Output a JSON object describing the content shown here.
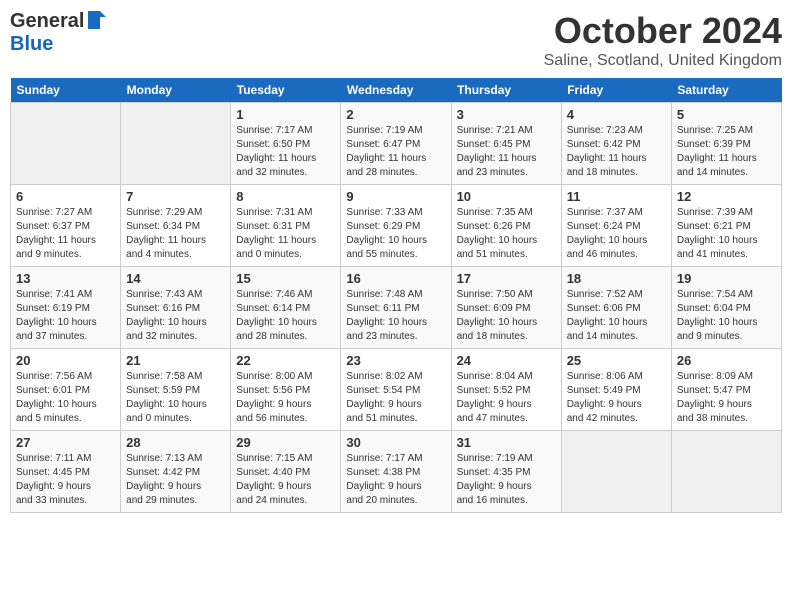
{
  "header": {
    "logo_general": "General",
    "logo_blue": "Blue",
    "month": "October 2024",
    "location": "Saline, Scotland, United Kingdom"
  },
  "days_of_week": [
    "Sunday",
    "Monday",
    "Tuesday",
    "Wednesday",
    "Thursday",
    "Friday",
    "Saturday"
  ],
  "weeks": [
    [
      {
        "date": "",
        "lines": []
      },
      {
        "date": "",
        "lines": []
      },
      {
        "date": "1",
        "lines": [
          "Sunrise: 7:17 AM",
          "Sunset: 6:50 PM",
          "Daylight: 11 hours",
          "and 32 minutes."
        ]
      },
      {
        "date": "2",
        "lines": [
          "Sunrise: 7:19 AM",
          "Sunset: 6:47 PM",
          "Daylight: 11 hours",
          "and 28 minutes."
        ]
      },
      {
        "date": "3",
        "lines": [
          "Sunrise: 7:21 AM",
          "Sunset: 6:45 PM",
          "Daylight: 11 hours",
          "and 23 minutes."
        ]
      },
      {
        "date": "4",
        "lines": [
          "Sunrise: 7:23 AM",
          "Sunset: 6:42 PM",
          "Daylight: 11 hours",
          "and 18 minutes."
        ]
      },
      {
        "date": "5",
        "lines": [
          "Sunrise: 7:25 AM",
          "Sunset: 6:39 PM",
          "Daylight: 11 hours",
          "and 14 minutes."
        ]
      }
    ],
    [
      {
        "date": "6",
        "lines": [
          "Sunrise: 7:27 AM",
          "Sunset: 6:37 PM",
          "Daylight: 11 hours",
          "and 9 minutes."
        ]
      },
      {
        "date": "7",
        "lines": [
          "Sunrise: 7:29 AM",
          "Sunset: 6:34 PM",
          "Daylight: 11 hours",
          "and 4 minutes."
        ]
      },
      {
        "date": "8",
        "lines": [
          "Sunrise: 7:31 AM",
          "Sunset: 6:31 PM",
          "Daylight: 11 hours",
          "and 0 minutes."
        ]
      },
      {
        "date": "9",
        "lines": [
          "Sunrise: 7:33 AM",
          "Sunset: 6:29 PM",
          "Daylight: 10 hours",
          "and 55 minutes."
        ]
      },
      {
        "date": "10",
        "lines": [
          "Sunrise: 7:35 AM",
          "Sunset: 6:26 PM",
          "Daylight: 10 hours",
          "and 51 minutes."
        ]
      },
      {
        "date": "11",
        "lines": [
          "Sunrise: 7:37 AM",
          "Sunset: 6:24 PM",
          "Daylight: 10 hours",
          "and 46 minutes."
        ]
      },
      {
        "date": "12",
        "lines": [
          "Sunrise: 7:39 AM",
          "Sunset: 6:21 PM",
          "Daylight: 10 hours",
          "and 41 minutes."
        ]
      }
    ],
    [
      {
        "date": "13",
        "lines": [
          "Sunrise: 7:41 AM",
          "Sunset: 6:19 PM",
          "Daylight: 10 hours",
          "and 37 minutes."
        ]
      },
      {
        "date": "14",
        "lines": [
          "Sunrise: 7:43 AM",
          "Sunset: 6:16 PM",
          "Daylight: 10 hours",
          "and 32 minutes."
        ]
      },
      {
        "date": "15",
        "lines": [
          "Sunrise: 7:46 AM",
          "Sunset: 6:14 PM",
          "Daylight: 10 hours",
          "and 28 minutes."
        ]
      },
      {
        "date": "16",
        "lines": [
          "Sunrise: 7:48 AM",
          "Sunset: 6:11 PM",
          "Daylight: 10 hours",
          "and 23 minutes."
        ]
      },
      {
        "date": "17",
        "lines": [
          "Sunrise: 7:50 AM",
          "Sunset: 6:09 PM",
          "Daylight: 10 hours",
          "and 18 minutes."
        ]
      },
      {
        "date": "18",
        "lines": [
          "Sunrise: 7:52 AM",
          "Sunset: 6:06 PM",
          "Daylight: 10 hours",
          "and 14 minutes."
        ]
      },
      {
        "date": "19",
        "lines": [
          "Sunrise: 7:54 AM",
          "Sunset: 6:04 PM",
          "Daylight: 10 hours",
          "and 9 minutes."
        ]
      }
    ],
    [
      {
        "date": "20",
        "lines": [
          "Sunrise: 7:56 AM",
          "Sunset: 6:01 PM",
          "Daylight: 10 hours",
          "and 5 minutes."
        ]
      },
      {
        "date": "21",
        "lines": [
          "Sunrise: 7:58 AM",
          "Sunset: 5:59 PM",
          "Daylight: 10 hours",
          "and 0 minutes."
        ]
      },
      {
        "date": "22",
        "lines": [
          "Sunrise: 8:00 AM",
          "Sunset: 5:56 PM",
          "Daylight: 9 hours",
          "and 56 minutes."
        ]
      },
      {
        "date": "23",
        "lines": [
          "Sunrise: 8:02 AM",
          "Sunset: 5:54 PM",
          "Daylight: 9 hours",
          "and 51 minutes."
        ]
      },
      {
        "date": "24",
        "lines": [
          "Sunrise: 8:04 AM",
          "Sunset: 5:52 PM",
          "Daylight: 9 hours",
          "and 47 minutes."
        ]
      },
      {
        "date": "25",
        "lines": [
          "Sunrise: 8:06 AM",
          "Sunset: 5:49 PM",
          "Daylight: 9 hours",
          "and 42 minutes."
        ]
      },
      {
        "date": "26",
        "lines": [
          "Sunrise: 8:09 AM",
          "Sunset: 5:47 PM",
          "Daylight: 9 hours",
          "and 38 minutes."
        ]
      }
    ],
    [
      {
        "date": "27",
        "lines": [
          "Sunrise: 7:11 AM",
          "Sunset: 4:45 PM",
          "Daylight: 9 hours",
          "and 33 minutes."
        ]
      },
      {
        "date": "28",
        "lines": [
          "Sunrise: 7:13 AM",
          "Sunset: 4:42 PM",
          "Daylight: 9 hours",
          "and 29 minutes."
        ]
      },
      {
        "date": "29",
        "lines": [
          "Sunrise: 7:15 AM",
          "Sunset: 4:40 PM",
          "Daylight: 9 hours",
          "and 24 minutes."
        ]
      },
      {
        "date": "30",
        "lines": [
          "Sunrise: 7:17 AM",
          "Sunset: 4:38 PM",
          "Daylight: 9 hours",
          "and 20 minutes."
        ]
      },
      {
        "date": "31",
        "lines": [
          "Sunrise: 7:19 AM",
          "Sunset: 4:35 PM",
          "Daylight: 9 hours",
          "and 16 minutes."
        ]
      },
      {
        "date": "",
        "lines": []
      },
      {
        "date": "",
        "lines": []
      }
    ]
  ]
}
